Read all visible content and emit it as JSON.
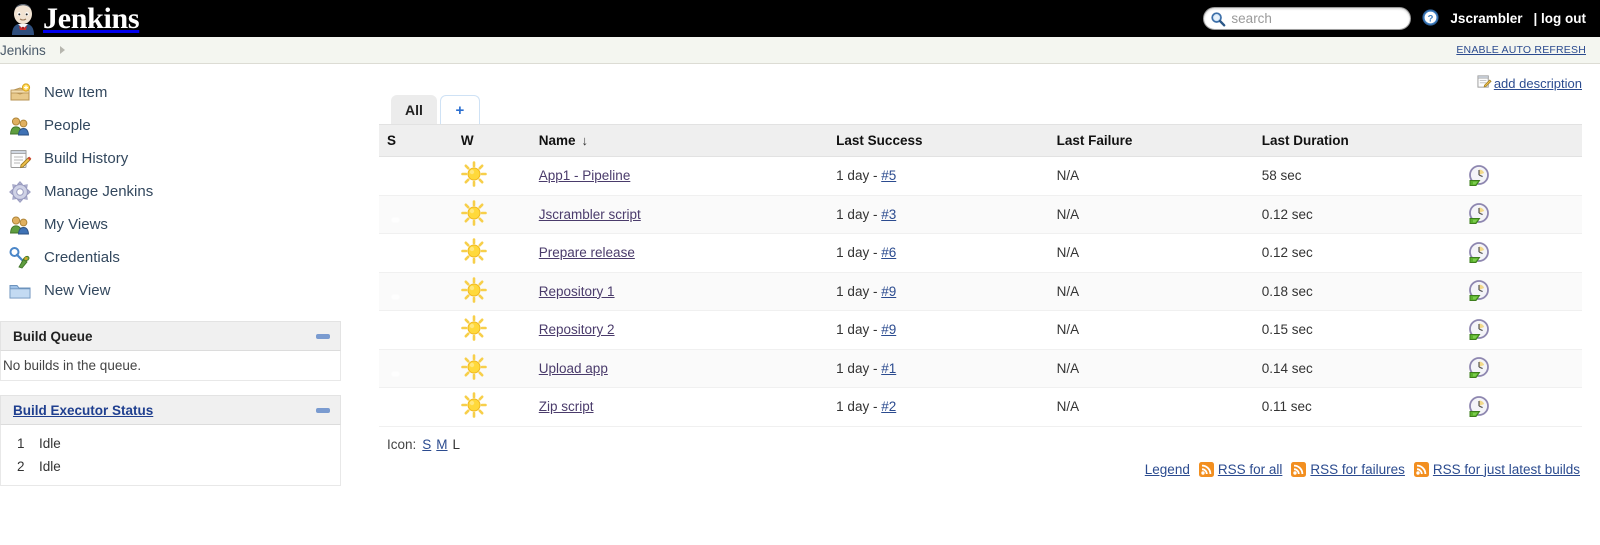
{
  "header": {
    "brand": "Jenkins",
    "search_placeholder": "search",
    "search_value": "",
    "help_icon": "help-icon",
    "search_icon": "search-icon",
    "user": "Jscrambler",
    "logout": "| log out"
  },
  "breadcrumb": {
    "items": [
      "Jenkins"
    ],
    "auto_refresh": "ENABLE AUTO REFRESH"
  },
  "sidebar": {
    "tasks": [
      {
        "label": "New Item",
        "icon": "new-item-icon"
      },
      {
        "label": "People",
        "icon": "people-icon"
      },
      {
        "label": "Build History",
        "icon": "build-history-icon"
      },
      {
        "label": "Manage Jenkins",
        "icon": "gear-icon"
      },
      {
        "label": "My Views",
        "icon": "my-views-icon"
      },
      {
        "label": "Credentials",
        "icon": "credentials-key-icon"
      },
      {
        "label": "New View",
        "icon": "folder-icon"
      }
    ],
    "build_queue": {
      "title": "Build Queue",
      "empty_text": "No builds in the queue.",
      "collapse_icon": "collapse-icon"
    },
    "build_executor_status": {
      "title": "Build Executor Status",
      "collapse_icon": "collapse-icon",
      "executors": [
        {
          "num": "1",
          "state": "Idle"
        },
        {
          "num": "2",
          "state": "Idle"
        }
      ]
    }
  },
  "main": {
    "add_description": "add description",
    "add_description_icon": "edit-description-icon",
    "tabs": [
      {
        "label": "All",
        "active": true
      },
      {
        "label": "+",
        "active": false
      }
    ],
    "table": {
      "columns": [
        "S",
        "W",
        "Name",
        "Last Success",
        "Last Failure",
        "Last Duration",
        ""
      ],
      "sort_column": "Name",
      "sort_arrow": "↓",
      "rows": [
        {
          "status_icon": "blue-ball-icon",
          "weather_icon": "sunny-icon",
          "name": "App1 - Pipeline",
          "last_success_age": "1 day - ",
          "last_success_build": "#5",
          "last_failure": "N/A",
          "last_duration": "58 sec",
          "build_icon": "schedule-build-icon"
        },
        {
          "status_icon": "blue-ball-icon",
          "weather_icon": "sunny-icon",
          "name": "Jscrambler script",
          "last_success_age": "1 day - ",
          "last_success_build": "#3",
          "last_failure": "N/A",
          "last_duration": "0.12 sec",
          "build_icon": "schedule-build-icon"
        },
        {
          "status_icon": "blue-ball-icon",
          "weather_icon": "sunny-icon",
          "name": "Prepare release",
          "last_success_age": "1 day - ",
          "last_success_build": "#6",
          "last_failure": "N/A",
          "last_duration": "0.12 sec",
          "build_icon": "schedule-build-icon"
        },
        {
          "status_icon": "blue-ball-icon",
          "weather_icon": "sunny-icon",
          "name": "Repository 1",
          "last_success_age": "1 day - ",
          "last_success_build": "#9",
          "last_failure": "N/A",
          "last_duration": "0.18 sec",
          "build_icon": "schedule-build-icon"
        },
        {
          "status_icon": "blue-ball-icon",
          "weather_icon": "sunny-icon",
          "name": "Repository 2",
          "last_success_age": "1 day - ",
          "last_success_build": "#9",
          "last_failure": "N/A",
          "last_duration": "0.15 sec",
          "build_icon": "schedule-build-icon"
        },
        {
          "status_icon": "blue-ball-icon",
          "weather_icon": "sunny-icon",
          "name": "Upload app",
          "last_success_age": "1 day - ",
          "last_success_build": "#1",
          "last_failure": "N/A",
          "last_duration": "0.14 sec",
          "build_icon": "schedule-build-icon"
        },
        {
          "status_icon": "blue-ball-icon",
          "weather_icon": "sunny-icon",
          "name": "Zip script",
          "last_success_age": "1 day - ",
          "last_success_build": "#2",
          "last_failure": "N/A",
          "last_duration": "0.11 sec",
          "build_icon": "schedule-build-icon"
        }
      ]
    },
    "icon_legend": {
      "label": "Icon:",
      "sizes": [
        {
          "label": "S",
          "current": false
        },
        {
          "label": "M",
          "current": false
        },
        {
          "label": "L",
          "current": true
        }
      ]
    },
    "footer_links": {
      "legend": "Legend",
      "rss": [
        {
          "label": "RSS for all",
          "icon": "rss-icon"
        },
        {
          "label": "RSS for failures",
          "icon": "rss-icon"
        },
        {
          "label": "RSS for just latest builds",
          "icon": "rss-icon"
        }
      ]
    }
  },
  "colors": {
    "topbar_bg": "#000000",
    "breadcrumb_bg": "#f4f6f0",
    "link": "#2b4b8f",
    "job_link": "#4a3b6b",
    "table_header_bg": "#efefef",
    "row_alt_bg": "#fafafa",
    "status_ball": "#4f8fc6",
    "weather_sun": "#f5c518",
    "rss_orange": "#f28f20"
  }
}
